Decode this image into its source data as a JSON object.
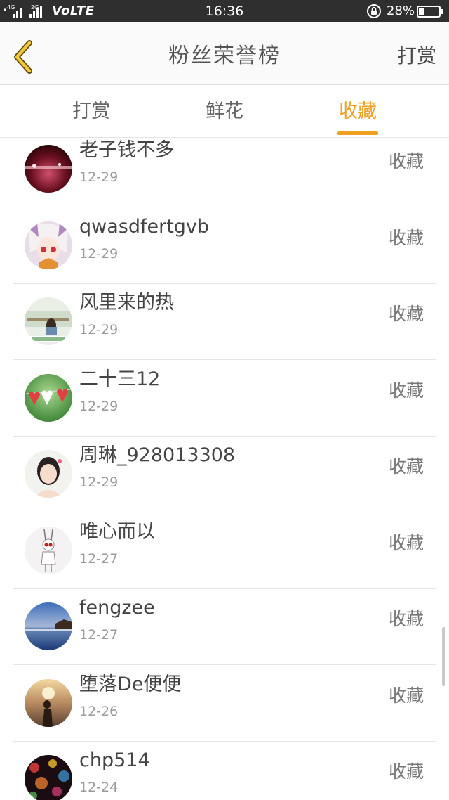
{
  "status_bar": {
    "signal_labels": [
      "4G",
      "2G"
    ],
    "network": "VoLTE",
    "time": "16:36",
    "battery": "28%",
    "battery_level": 0.28
  },
  "header": {
    "back_icon": "chevron-left-icon",
    "title": "粉丝荣誉榜",
    "right_action": "打赏"
  },
  "tabs": [
    {
      "label": "打赏",
      "active": false
    },
    {
      "label": "鲜花",
      "active": false
    },
    {
      "label": "收藏",
      "active": true
    }
  ],
  "accent_color": "#f0a020",
  "list": [
    {
      "name": "老子钱不多",
      "date": "12-29",
      "action": "收藏"
    },
    {
      "name": "qwasdfertgvb",
      "date": "12-29",
      "action": "收藏"
    },
    {
      "name": "风里来的热",
      "date": "12-29",
      "action": "收藏"
    },
    {
      "name": "二十三12",
      "date": "12-29",
      "action": "收藏"
    },
    {
      "name": "周琳_928013308",
      "date": "12-29",
      "action": "收藏"
    },
    {
      "name": "唯心而以",
      "date": "12-27",
      "action": "收藏"
    },
    {
      "name": "fengzee",
      "date": "12-27",
      "action": "收藏"
    },
    {
      "name": "堕落De便便",
      "date": "12-26",
      "action": "收藏"
    },
    {
      "name": "chp514",
      "date": "12-24",
      "action": "收藏"
    }
  ]
}
